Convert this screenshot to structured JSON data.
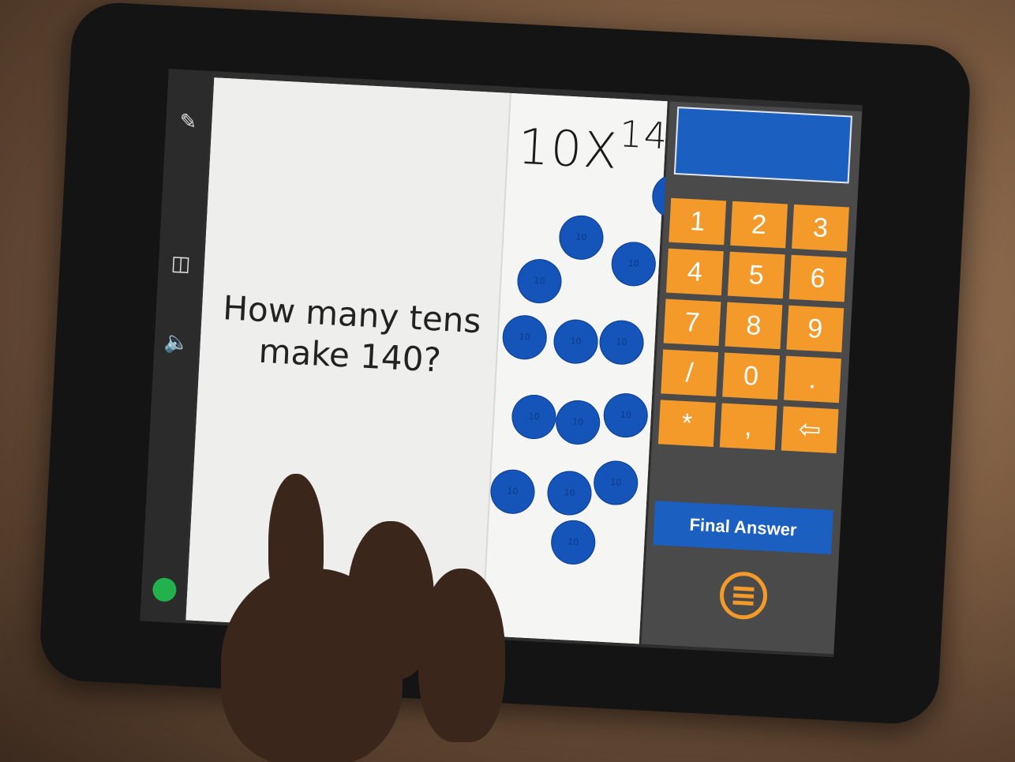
{
  "toolbar": {
    "pencil_icon": "pencil-icon",
    "layout_icon": "layout-icon",
    "speaker_icon": "speaker-icon",
    "status_color": "#22b14c"
  },
  "question": {
    "line1": "How many tens",
    "line2": "make 140?"
  },
  "work": {
    "handwritten_main": "10X",
    "handwritten_sup": "14",
    "chip_label": "10",
    "chip_count": 14
  },
  "answer": {
    "value": ""
  },
  "keypad": {
    "keys": [
      "1",
      "2",
      "3",
      "4",
      "5",
      "6",
      "7",
      "8",
      "9",
      "/",
      "0",
      ".",
      "*",
      ",",
      "⇦"
    ]
  },
  "final_answer_label": "Final Answer",
  "colors": {
    "key_orange": "#f39a2a",
    "accent_blue": "#1b5fc1",
    "panel_gray": "#4a4a4a"
  }
}
